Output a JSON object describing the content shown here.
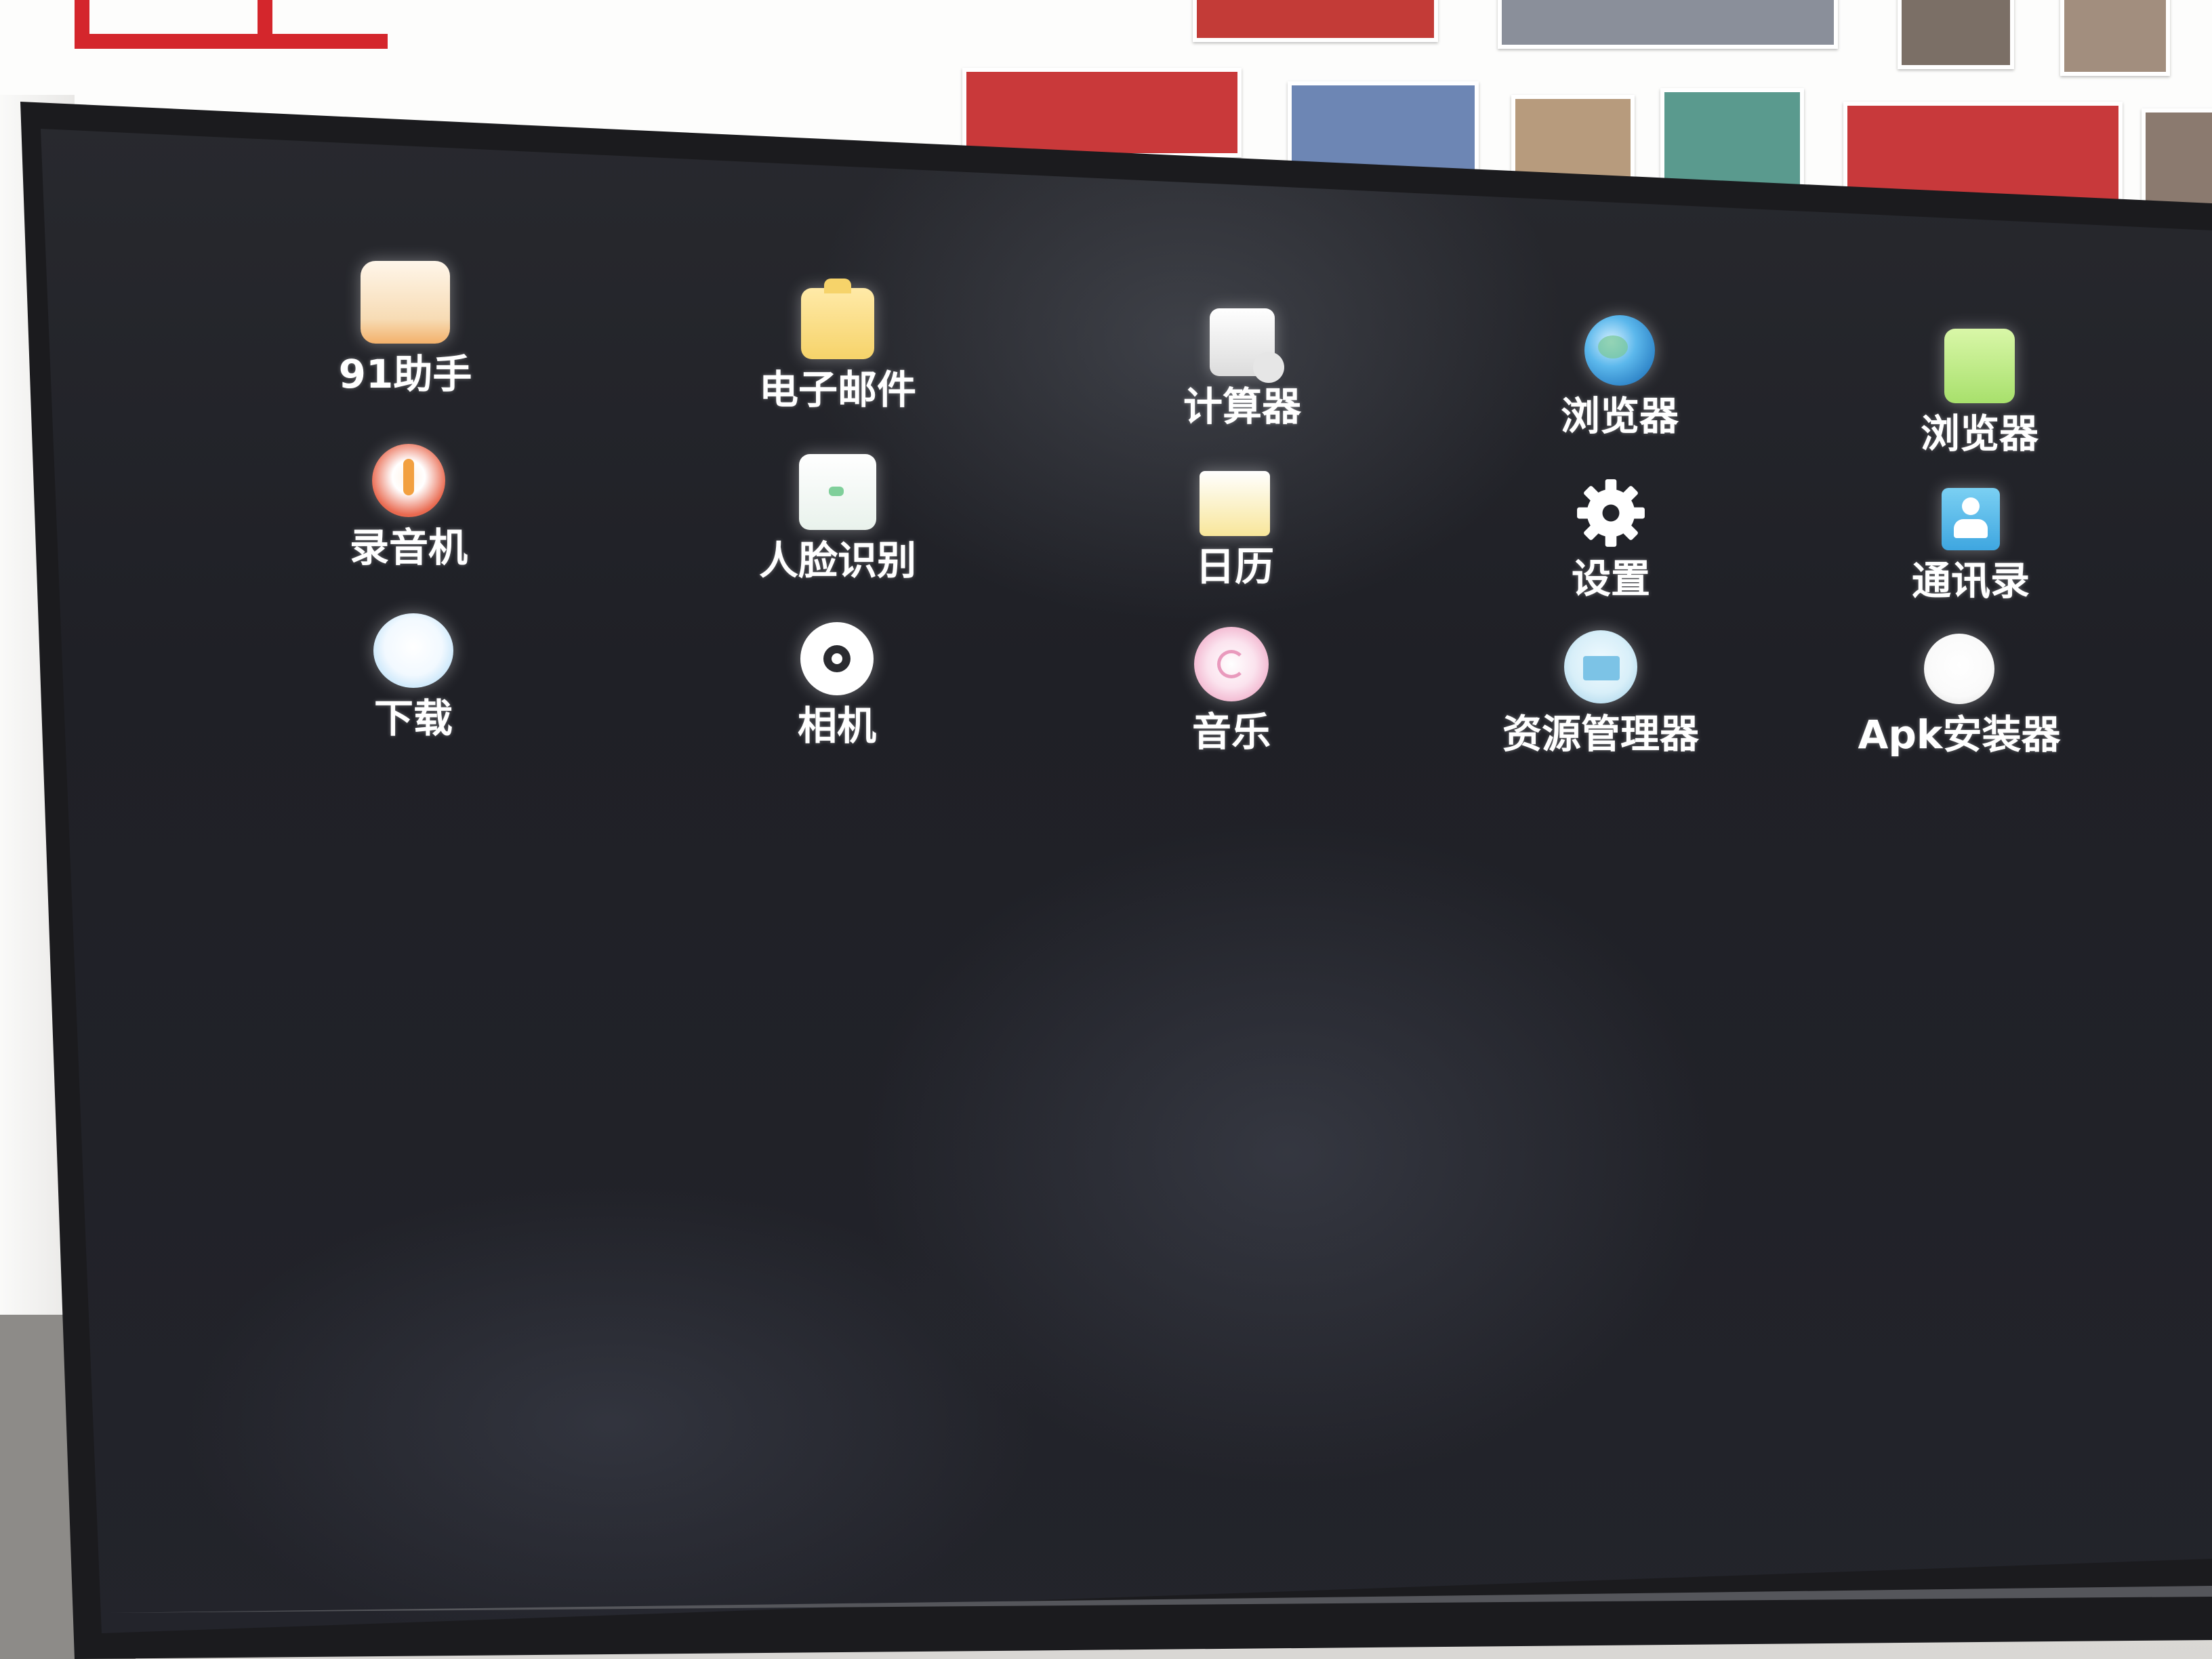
{
  "screen": {
    "description_colors": {
      "background": "#1f2026",
      "label": "#ffffff"
    },
    "apps": [
      {
        "label": "91助手",
        "icon": "91-assistant-icon",
        "color": "#f7dcb5"
      },
      {
        "label": "电子邮件",
        "icon": "email-icon",
        "color": "#f6d36a"
      },
      {
        "label": "计算器",
        "icon": "calculator-icon",
        "color": "#ececec"
      },
      {
        "label": "浏览器",
        "icon": "globe-browser-icon",
        "color": "#3f9ee0"
      },
      {
        "label": "浏览器",
        "icon": "green-browser-icon",
        "color": "#a8e06c"
      },
      {
        "label": "录音机",
        "icon": "recorder-icon",
        "color": "#e9694f"
      },
      {
        "label": "人脸识别",
        "icon": "face-recognition-icon",
        "color": "#e9f2ec"
      },
      {
        "label": "日历",
        "icon": "calendar-icon",
        "color": "#f8e69a"
      },
      {
        "label": "设置",
        "icon": "gear-icon",
        "color": "#ffffff"
      },
      {
        "label": "通讯录",
        "icon": "contacts-icon",
        "color": "#4fb6e8"
      },
      {
        "label": "下载",
        "icon": "download-icon",
        "color": "#9fd3f4"
      },
      {
        "label": "相机",
        "icon": "camera-icon",
        "color": "#ffffff"
      },
      {
        "label": "音乐",
        "icon": "music-icon",
        "color": "#f2b6cf"
      },
      {
        "label": "资源管理器",
        "icon": "folder-icon",
        "color": "#bfe2f5"
      },
      {
        "label": "Apk安装器",
        "icon": "apk-installer-icon",
        "color": "#f4f4f4"
      }
    ]
  }
}
